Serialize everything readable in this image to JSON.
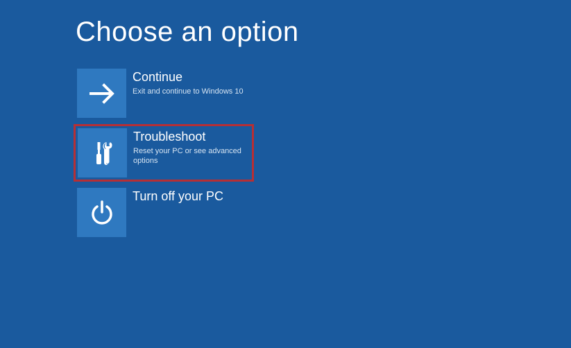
{
  "heading": "Choose an option",
  "options": {
    "continue": {
      "title": "Continue",
      "desc": "Exit and continue to Windows 10"
    },
    "troubleshoot": {
      "title": "Troubleshoot",
      "desc": "Reset your PC or see advanced options"
    },
    "turnoff": {
      "title": "Turn off your PC"
    }
  },
  "colors": {
    "background": "#1a5a9e",
    "tile": "#2f79c0",
    "highlight": "#b62f35"
  }
}
